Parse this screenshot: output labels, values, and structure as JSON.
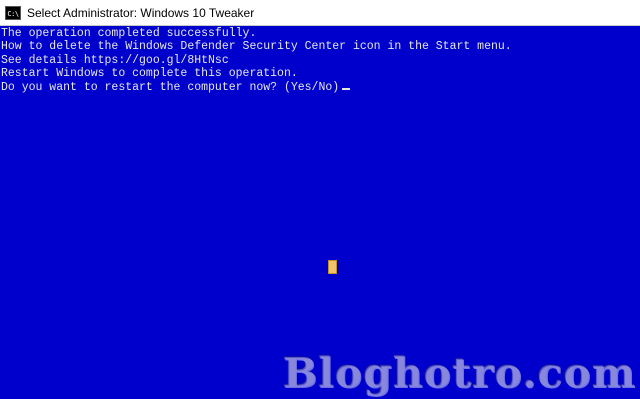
{
  "window": {
    "icon_text": "C:\\",
    "title": "Select Administrator:  Windows 10 Tweaker"
  },
  "console": {
    "lines": [
      "The operation completed successfully.",
      "How to delete the Windows Defender Security Center icon in the Start menu.",
      "See details https://goo.gl/8HtNsc",
      "Restart Windows to complete this operation.",
      "Do you want to restart the computer now? (Yes/No)"
    ]
  },
  "watermark": "Bloghotro.com",
  "colors": {
    "console_bg": "#0000cc",
    "console_text": "#e6e6e6",
    "mouse_block": "#f0c46a"
  }
}
